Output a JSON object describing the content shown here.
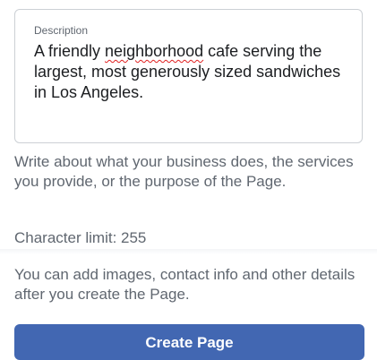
{
  "description_field": {
    "label": "Description",
    "value_before": "A friendly ",
    "misspelled_word": "neighborhood",
    "value_after": " cafe serving the largest, most generously sized sandwiches in Los Angeles."
  },
  "help_text": "Write about what your business does, the services you provide, or the purpose of the Page.",
  "character_limit": "Character limit: 255",
  "info_text": "You can add images, contact info and other details after you create the Page.",
  "create_button": {
    "label": "Create Page"
  },
  "colors": {
    "primary_button": "#4267b2",
    "secondary_text": "#606770",
    "spellcheck_underline": "#e02020"
  }
}
